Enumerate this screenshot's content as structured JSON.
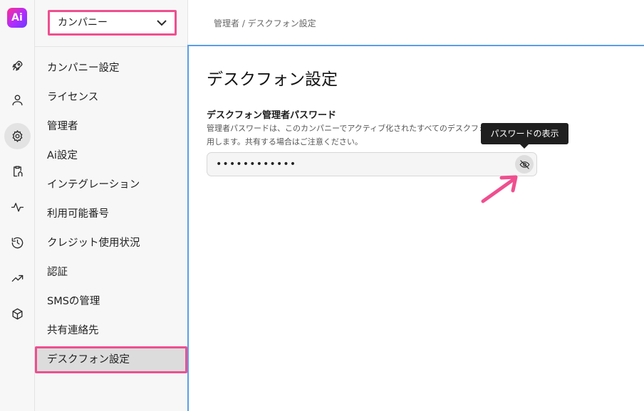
{
  "app": {
    "logo_text": "Ai",
    "brand_gradient": [
      "#ff2f8e",
      "#6a3bff"
    ]
  },
  "rail": {
    "icons": [
      {
        "name": "rocket-icon",
        "active": false
      },
      {
        "name": "user-icon",
        "active": false
      },
      {
        "name": "gear-icon",
        "active": true
      },
      {
        "name": "clipboard-icon",
        "active": false
      },
      {
        "name": "activity-icon",
        "active": false
      },
      {
        "name": "history-icon",
        "active": false
      },
      {
        "name": "trending-icon",
        "active": false
      },
      {
        "name": "cube-icon",
        "active": false
      }
    ]
  },
  "sidebar": {
    "company_select": {
      "value": "カンパニー"
    },
    "items": [
      {
        "label": "カンパニー設定"
      },
      {
        "label": "ライセンス"
      },
      {
        "label": "管理者"
      },
      {
        "label": "Ai設定"
      },
      {
        "label": "インテグレーション"
      },
      {
        "label": "利用可能番号"
      },
      {
        "label": "クレジット使用状況"
      },
      {
        "label": "認証"
      },
      {
        "label": "SMSの管理"
      },
      {
        "label": "共有連絡先"
      },
      {
        "label": "デスクフォン設定",
        "active": true
      }
    ]
  },
  "breadcrumb": "管理者 / デスクフォン設定",
  "main": {
    "title": "デスクフォン設定",
    "field_label": "デスクフォン管理者パスワード",
    "field_desc_line1": "管理者パスワードは、このカンパニーでアクティブ化されたすべてのデスクフォンに適",
    "field_desc_line2": "用します。共有する場合はご注意ください。",
    "password_value": "••••••••••••",
    "tooltip": "パスワードの表示"
  },
  "colors": {
    "highlight": "#ef4f8f",
    "focus_border": "#5a9ee8"
  }
}
